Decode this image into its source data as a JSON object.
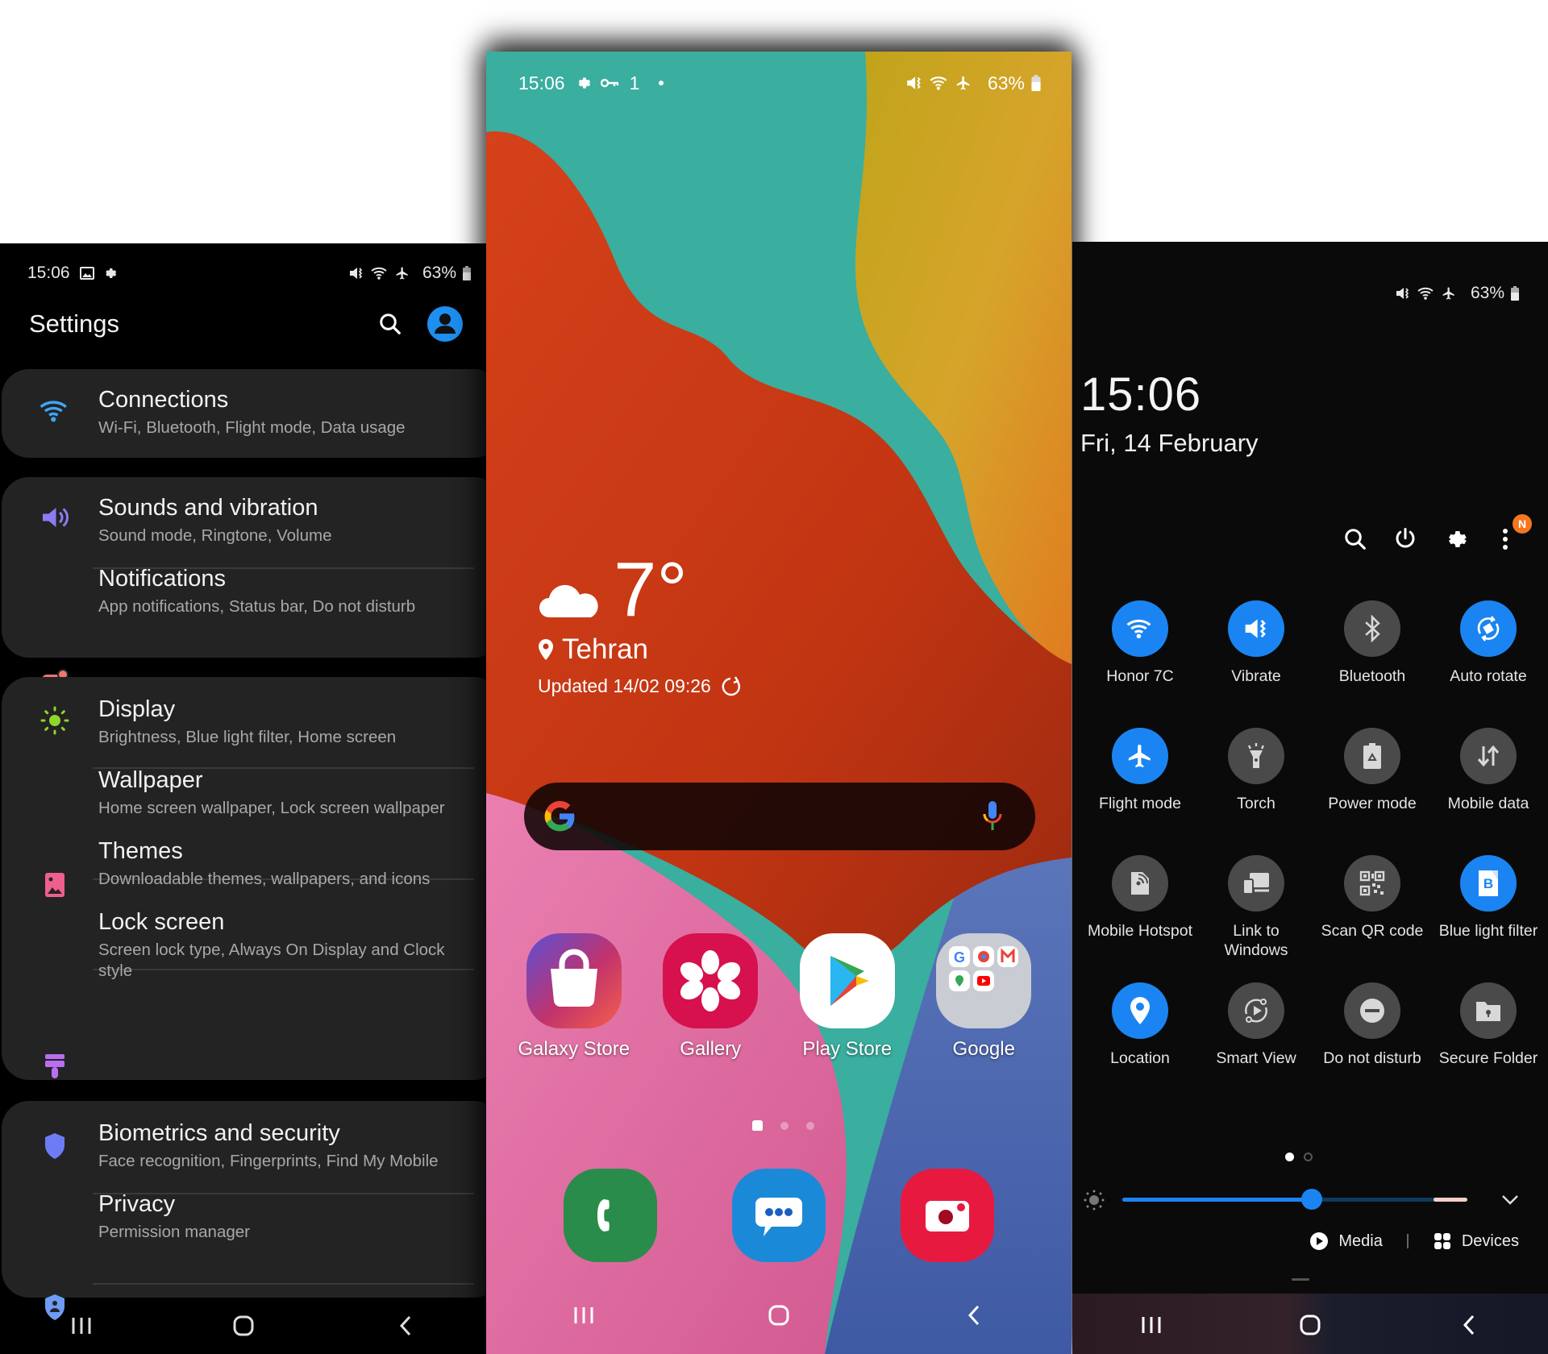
{
  "settings_phone": {
    "status": {
      "time": "15:06",
      "battery": "63%",
      "left_icons": [
        "gallery-icon",
        "gear-icon"
      ],
      "right_icons": [
        "vibrate-icon",
        "wifi-icon",
        "airplane-icon",
        "battery-icon"
      ]
    },
    "title": "Settings",
    "groups": [
      [
        {
          "title": "Connections",
          "subtitle": "Wi-Fi, Bluetooth, Flight mode, Data usage",
          "icon": "wifi-icon",
          "color": "#3ea6f5"
        }
      ],
      [
        {
          "title": "Sounds and vibration",
          "subtitle": "Sound mode, Ringtone, Volume",
          "icon": "speaker-icon",
          "color": "#8a7cf2"
        },
        {
          "title": "Notifications",
          "subtitle": "App notifications, Status bar, Do not disturb",
          "icon": "notification-icon",
          "color": "#f0766b"
        }
      ],
      [
        {
          "title": "Display",
          "subtitle": "Brightness, Blue light filter, Home screen",
          "icon": "sun-icon",
          "color": "#8fd62a"
        },
        {
          "title": "Wallpaper",
          "subtitle": "Home screen wallpaper, Lock screen wallpaper",
          "icon": "wallpaper-icon",
          "color": "#ef5f8e"
        },
        {
          "title": "Themes",
          "subtitle": "Downloadable themes, wallpapers, and icons",
          "icon": "paint-brush-icon",
          "color": "#b86ff0"
        },
        {
          "title": "Lock screen",
          "subtitle": "Screen lock type, Always On Display and Clock style",
          "icon": "lock-icon",
          "color": "#22b3a0"
        }
      ],
      [
        {
          "title": "Biometrics and security",
          "subtitle": "Face recognition, Fingerprints, Find My Mobile",
          "icon": "shield-icon",
          "color": "#6d7cf5"
        },
        {
          "title": "Privacy",
          "subtitle": "Permission manager",
          "icon": "privacy-shield-icon",
          "color": "#6d9cf5"
        }
      ]
    ]
  },
  "home_phone": {
    "status": {
      "time": "15:06",
      "notif_count": "1",
      "battery": "63%"
    },
    "weather": {
      "temperature": "7°",
      "city": "Tehran",
      "updated": "Updated 14/02 09:26",
      "condition": "cloudy"
    },
    "search": {
      "placeholder": ""
    },
    "apps": [
      {
        "label": "Galaxy Store"
      },
      {
        "label": "Gallery"
      },
      {
        "label": "Play Store"
      },
      {
        "label": "Google"
      }
    ],
    "page_indicator": {
      "pages": 3,
      "current": 0
    },
    "dock": [
      {
        "name": "Phone"
      },
      {
        "name": "Messages"
      },
      {
        "name": "Camera"
      }
    ]
  },
  "quick_panel": {
    "status": {
      "battery": "63%"
    },
    "clock": "15:06",
    "date": "Fri, 14 February",
    "notification_badge": "N",
    "tiles": [
      {
        "label": "Honor 7C",
        "icon": "wifi-icon",
        "on": true
      },
      {
        "label": "Vibrate",
        "icon": "vibrate-icon",
        "on": true
      },
      {
        "label": "Bluetooth",
        "icon": "bluetooth-icon",
        "on": false
      },
      {
        "label": "Auto rotate",
        "icon": "auto-rotate-icon",
        "on": true
      },
      {
        "label": "Flight mode",
        "icon": "airplane-icon",
        "on": true
      },
      {
        "label": "Torch",
        "icon": "torch-icon",
        "on": false
      },
      {
        "label": "Power mode",
        "icon": "battery-recycle-icon",
        "on": false
      },
      {
        "label": "Mobile data",
        "icon": "mobile-data-icon",
        "on": false
      },
      {
        "label": "Mobile Hotspot",
        "icon": "hotspot-icon",
        "on": false
      },
      {
        "label": "Link to Windows",
        "icon": "link-windows-icon",
        "on": false
      },
      {
        "label": "Scan QR code",
        "icon": "qr-code-icon",
        "on": false
      },
      {
        "label": "Blue light filter",
        "icon": "blue-light-icon",
        "on": true
      },
      {
        "label": "Location",
        "icon": "location-pin-icon",
        "on": true
      },
      {
        "label": "Smart View",
        "icon": "smart-view-icon",
        "on": false
      },
      {
        "label": "Do not disturb",
        "icon": "do-not-disturb-icon",
        "on": false
      },
      {
        "label": "Secure Folder",
        "icon": "secure-folder-icon",
        "on": false
      }
    ],
    "page_dots": {
      "pages": 2,
      "current": 0
    },
    "brightness_percent": 55,
    "media_label": "Media",
    "devices_label": "Devices"
  },
  "colors": {
    "accent_blue": "#1a85f2",
    "tile_off": "#4a4a4a",
    "card_bg": "#232323",
    "badge_orange": "#f6761f"
  }
}
